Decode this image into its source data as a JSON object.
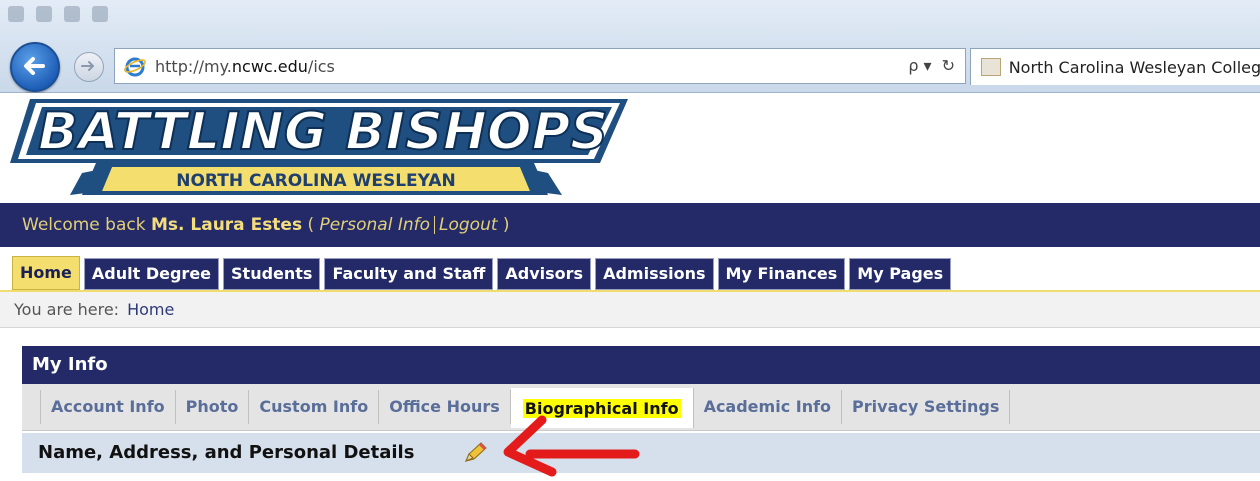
{
  "browser": {
    "url_prefix": "http://my.",
    "url_domain": "ncwc.edu",
    "url_suffix": "/ics",
    "tab_title": "North Carolina Wesleyan College",
    "search_glyph": "ρ ▾",
    "refresh_glyph": "↻"
  },
  "banner": {
    "logo_main": "BATTLING BISHOPS",
    "logo_sub": "NORTH CAROLINA WESLEYAN"
  },
  "welcome": {
    "prefix": "Welcome back ",
    "name": "Ms. Laura Estes",
    "open_paren": " ( ",
    "personal_info": "Personal Info",
    "logout": "Logout",
    "close_paren": " )"
  },
  "nav": {
    "tabs": [
      {
        "label": "Home",
        "active": true
      },
      {
        "label": "Adult Degree"
      },
      {
        "label": "Students"
      },
      {
        "label": "Faculty and Staff"
      },
      {
        "label": "Advisors"
      },
      {
        "label": "Admissions"
      },
      {
        "label": "My Finances"
      },
      {
        "label": "My Pages"
      }
    ]
  },
  "breadcrumb": {
    "prefix": "You are here:",
    "current": "Home"
  },
  "panel": {
    "title": "My Info",
    "subtabs": [
      {
        "label": "Account Info"
      },
      {
        "label": "Photo"
      },
      {
        "label": "Custom Info"
      },
      {
        "label": "Office Hours"
      },
      {
        "label": "Biographical Info",
        "active": true
      },
      {
        "label": "Academic Info"
      },
      {
        "label": "Privacy Settings"
      }
    ],
    "section_title": "Name, Address, and Personal Details"
  },
  "colors": {
    "navy": "#232a67",
    "gold": "#f4df6e",
    "highlight": "#ffff00",
    "arrow": "#e31b1b"
  }
}
